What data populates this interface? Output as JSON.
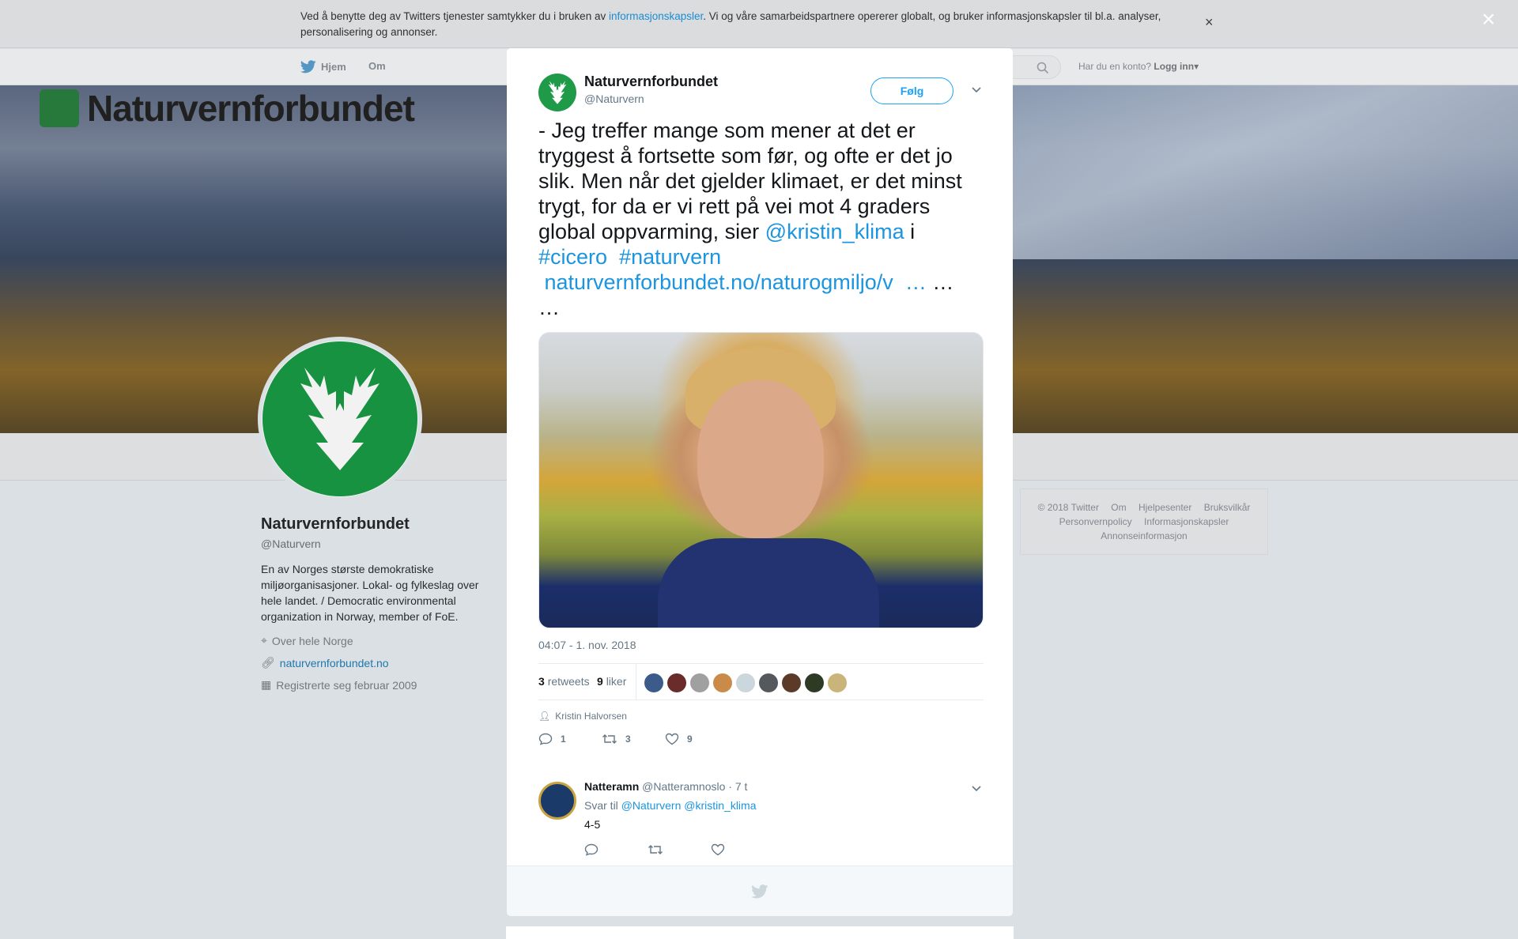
{
  "cookie_bar": {
    "text_before": "Ved å benytte deg av Twitters tjenester samtykker du i bruken av ",
    "link": "informasjonskapsler",
    "text_after": ". Vi og våre samarbeidspartnere opererer globalt, og bruker informasjonskapsler til bl.a. analyser, personalisering og annonser.",
    "close": "×"
  },
  "nav": {
    "home": "Hjem",
    "about": "Om",
    "login_prompt": "Har du en konto?",
    "login": "Logg inn"
  },
  "banner": {
    "logo_text": "Naturvernforbundet"
  },
  "profile": {
    "name": "Naturvernforbundet",
    "handle": "@Naturvern",
    "bio": "En av Norges største demokratiske miljøorganisasjoner. Lokal- og fylkeslag over hele landet. / Democratic environmental organization in Norway, member of FoE.",
    "location": "Over hele Norge",
    "website": "naturvernforbundet.no",
    "joined": "Registrerte seg februar 2009"
  },
  "footer": {
    "items": [
      "© 2018 Twitter",
      "Om",
      "Hjelpesenter",
      "Bruksvilkår",
      "Personvernpolicy",
      "Informasjonskapsler",
      "Annonseinformasjon"
    ]
  },
  "modal": {
    "close": "×",
    "author_name": "Naturvernforbundet",
    "author_handle": "@Naturvern",
    "follow_label": "Følg",
    "tweet_text_main": "- Jeg treffer mange som mener at det er tryggest å fortsette som før, og ofte er det jo slik. Men når det gjelder klimaet, er det minst trygt, for da er vi rett på vei mot 4 graders global oppvarming, sier ",
    "mention": "@kristin_klima",
    "mention_after": " i",
    "hashtag1": "#cicero",
    "hashtag2": "#naturvern",
    "url": "naturvernforbundet.no/naturogmiljo/v",
    "url_ellipsis": "…",
    "trail1": " …",
    "trail2": "…",
    "timestamp": "04:07 - 1. nov. 2018",
    "retweets_count": "3",
    "retweets_label": "retweets",
    "likes_count": "9",
    "likes_label": "liker",
    "tagged_person": "Kristin Halvorsen",
    "reply_count": "1",
    "retweet_count": "3",
    "like_count": "9"
  },
  "reply": {
    "name": "Natteramn",
    "handle": "@Natteramnoslo",
    "time": "· 7 t",
    "reply_to_label": "Svar til",
    "reply_to": "@Naturvern @kristin_klima",
    "text": "4-5"
  },
  "colors": {
    "accent": "#1da1f2",
    "brand_green": "#1e9a48"
  }
}
